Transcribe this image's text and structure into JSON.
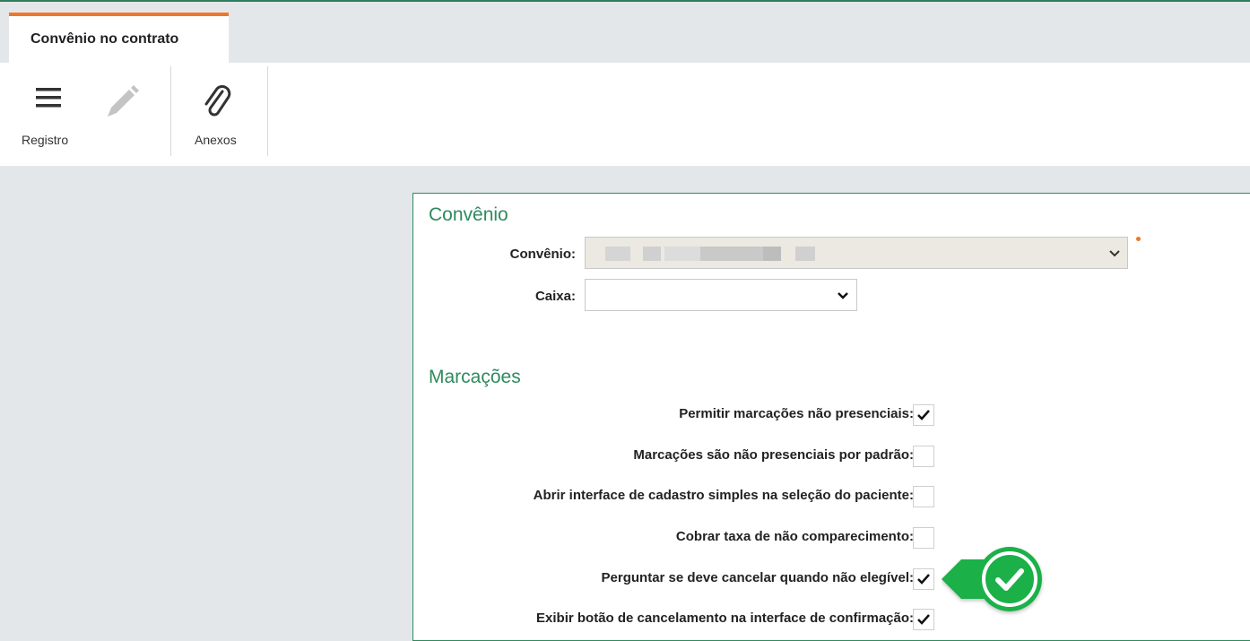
{
  "tab": {
    "label": "Convênio no contrato"
  },
  "toolbar": {
    "registro_label": "Registro",
    "anexos_label": "Anexos"
  },
  "convenio_section": {
    "title": "Convênio",
    "convenio_label": "Convênio:",
    "caixa_label": "Caixa:"
  },
  "marcacoes_section": {
    "title": "Marcações",
    "options": [
      {
        "label": "Permitir marcações não presenciais:",
        "checked": true
      },
      {
        "label": "Marcações são não presenciais por padrão:",
        "checked": false
      },
      {
        "label": "Abrir interface de cadastro simples na seleção do paciente:",
        "checked": false
      },
      {
        "label": "Cobrar taxa de não comparecimento:",
        "checked": false
      },
      {
        "label": "Perguntar se deve cancelar quando não elegível:",
        "checked": true
      },
      {
        "label": "Exibir botão de cancelamento na interface de confirmação:",
        "checked": true
      }
    ]
  },
  "colors": {
    "accent_green": "#2f8a5e",
    "tab_orange": "#f0772a",
    "callout_green": "#1fb04a"
  }
}
